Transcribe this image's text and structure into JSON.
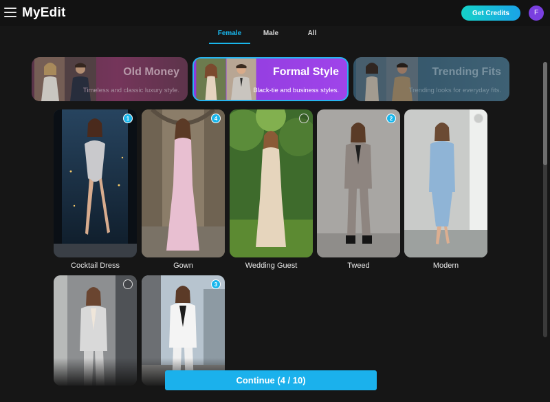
{
  "app": {
    "title": "MyEdit",
    "get_credits_label": "Get Credits",
    "avatar_initial": "F"
  },
  "gender_tabs": [
    {
      "label": "Female",
      "active": true
    },
    {
      "label": "Male",
      "active": false
    },
    {
      "label": "All",
      "active": false
    }
  ],
  "styles": [
    {
      "title": "Old Money",
      "description": "Timeless and classic luxury style.",
      "selected": false
    },
    {
      "title": "Formal Style",
      "description": "Black-tie and business styles.",
      "selected": true
    },
    {
      "title": "Trending Fits",
      "description": "Trending looks for everyday fits.",
      "selected": false
    }
  ],
  "outfits": [
    {
      "label": "Cocktail Dress",
      "badge": "1"
    },
    {
      "label": "Gown",
      "badge": "4"
    },
    {
      "label": "Wedding Guest",
      "badge": ""
    },
    {
      "label": "Tweed",
      "badge": "2"
    },
    {
      "label": "Modern",
      "badge": ""
    },
    {
      "label": "",
      "badge": ""
    },
    {
      "label": "",
      "badge": "3"
    }
  ],
  "continue": {
    "label": "Continue (4 / 10)"
  },
  "colors": {
    "accent": "#19b6ec",
    "purple": "#9b42e6",
    "credits_gradient_start": "#15d2c8"
  }
}
